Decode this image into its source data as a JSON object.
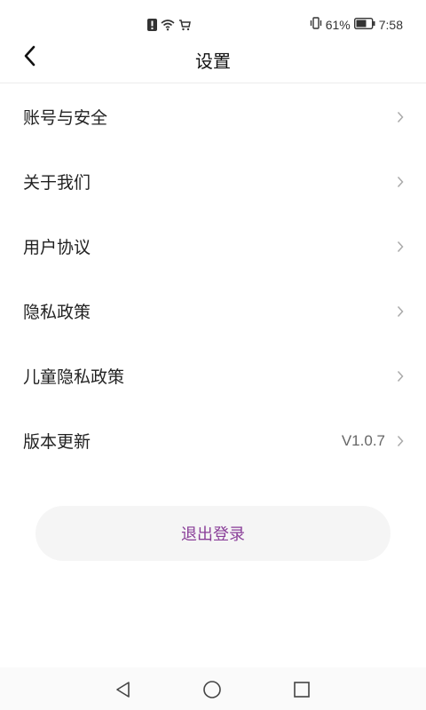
{
  "status_bar": {
    "icons_center": [
      "alert-icon",
      "wifi-icon",
      "cart-icon"
    ],
    "battery_percent": "61%",
    "time": "7:58"
  },
  "header": {
    "title": "设置",
    "back_icon": "chevron-left-icon"
  },
  "menu": {
    "items": [
      {
        "label": "账号与安全",
        "value": ""
      },
      {
        "label": "关于我们",
        "value": ""
      },
      {
        "label": "用户协议",
        "value": ""
      },
      {
        "label": "隐私政策",
        "value": ""
      },
      {
        "label": "儿童隐私政策",
        "value": ""
      },
      {
        "label": "版本更新",
        "value": "V1.0.7"
      }
    ]
  },
  "logout": {
    "label": "退出登录",
    "color": "#8a3f99"
  },
  "nav_bar": {
    "icons": [
      "back-triangle-icon",
      "home-circle-icon",
      "recents-square-icon"
    ]
  }
}
